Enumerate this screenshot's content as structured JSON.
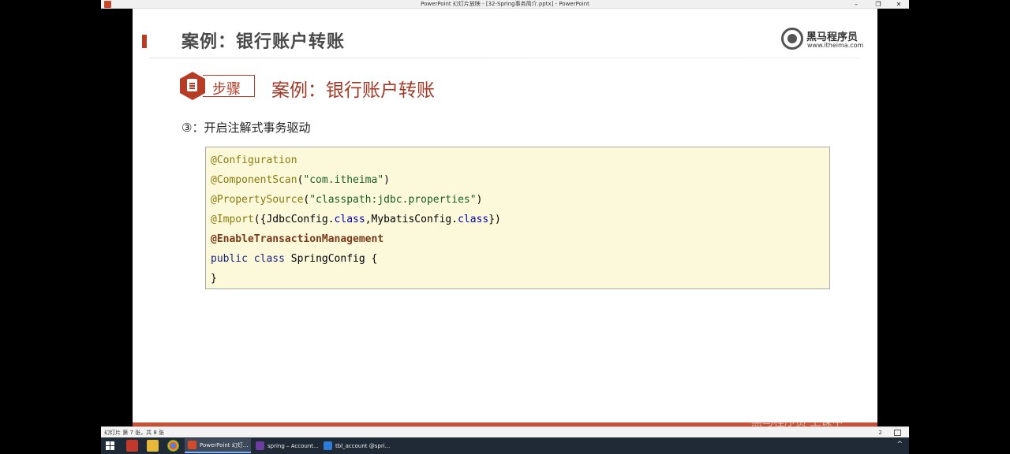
{
  "window": {
    "title": "PowerPoint 幻灯片放映 - [32-Spring事务简介.pptx] - PowerPoint",
    "minimize": "–",
    "restore": "❐",
    "close": "✕"
  },
  "slide": {
    "title": "案例：银行账户转账",
    "logo": {
      "name": "黑马程序员",
      "url": "www.itheima.com"
    },
    "step_badge": "步骤",
    "step_title": "案例：银行账户转账",
    "step_text": "③：开启注解式事务驱动",
    "code": {
      "line1": {
        "ann": "@Configuration"
      },
      "line2": {
        "ann": "@ComponentScan",
        "open": "(",
        "str": "\"com.itheima\"",
        "close": ")"
      },
      "line3": {
        "ann": "@PropertySource",
        "open": "(",
        "str": "\"classpath:jdbc.properties\"",
        "close": ")"
      },
      "line4": {
        "ann": "@Import",
        "p1": "({JdbcConfig.",
        "kw1": "class",
        "p2": ",MybatisConfig.",
        "kw2": "class",
        "p3": "})"
      },
      "line5": {
        "ann": "@EnableTransactionManagement"
      },
      "line6": {
        "kw_public": "public",
        "kw_class": "class",
        "name": "SpringConfig {"
      },
      "line7": {
        "text": "}"
      }
    }
  },
  "watermark": "黑马程序员 上课中",
  "statusbar": {
    "status": "幻灯片 第 7 张，共 8 张",
    "zoom": "2"
  },
  "taskbar": {
    "tasks": [
      {
        "label": "PowerPoint 幻灯..."
      },
      {
        "label": "spring – Account..."
      },
      {
        "label": "tbl_account @spri..."
      }
    ],
    "chevron": "^"
  },
  "colors": {
    "accent": "#b73c26",
    "code_bg": "#fbf9d9",
    "taskbar": "#1f2a36"
  }
}
